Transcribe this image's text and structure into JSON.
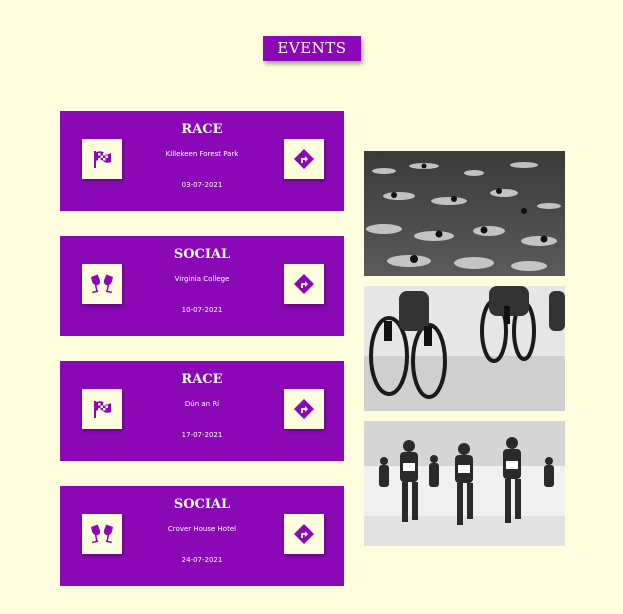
{
  "header": {
    "title": "EVENTS"
  },
  "colors": {
    "accent": "#8a08b5",
    "background": "#fefddd"
  },
  "events": [
    {
      "type": "RACE",
      "icon": "checkered-flag-icon",
      "location": "Killekeen Forest Park",
      "date": "03-07-2021"
    },
    {
      "type": "SOCIAL",
      "icon": "wine-glasses-icon",
      "location": "Virginia College",
      "date": "10-07-2021"
    },
    {
      "type": "RACE",
      "icon": "checkered-flag-icon",
      "location": "Dún an Rí",
      "date": "17-07-2021"
    },
    {
      "type": "SOCIAL",
      "icon": "wine-glasses-icon",
      "location": "Crover House Hotel",
      "date": "24-07-2021"
    }
  ],
  "photos": [
    "swimming-photo",
    "cycling-photo",
    "running-photo"
  ]
}
